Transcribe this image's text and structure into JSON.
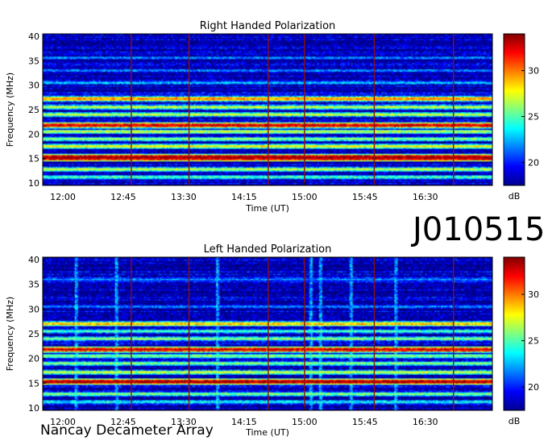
{
  "observation_id": "J010515",
  "instrument": "Nancay Decameter Array",
  "chart_data": [
    {
      "type": "heatmap",
      "title": "Right Handed Polarization",
      "xlabel": "Time (UT)",
      "ylabel": "Frequency (MHz)",
      "x_ticks": [
        "12:00",
        "12:45",
        "13:30",
        "14:15",
        "15:00",
        "15:45",
        "16:30"
      ],
      "x_range_minutes": [
        705,
        1040
      ],
      "x_tick_minutes": [
        720,
        765,
        810,
        855,
        900,
        945,
        990
      ],
      "y_ticks": [
        10,
        15,
        20,
        25,
        30,
        35,
        40
      ],
      "ylim": [
        9.5,
        40.5
      ],
      "colorbar": {
        "label": "dB",
        "ticks": [
          20,
          25,
          30
        ],
        "range": [
          17.5,
          34
        ]
      },
      "interference_bands_mhz": [
        {
          "f": 15.3,
          "level": 34
        },
        {
          "f": 15.0,
          "level": 33
        },
        {
          "f": 21.8,
          "level": 33
        },
        {
          "f": 20.5,
          "level": 27
        },
        {
          "f": 19.0,
          "level": 26
        },
        {
          "f": 17.5,
          "level": 28
        },
        {
          "f": 24.0,
          "level": 27
        },
        {
          "f": 25.5,
          "level": 27
        },
        {
          "f": 27.2,
          "level": 30
        },
        {
          "f": 12.8,
          "level": 27
        },
        {
          "f": 11.2,
          "level": 25
        },
        {
          "f": 30.5,
          "level": 23
        },
        {
          "f": 33.0,
          "level": 22
        },
        {
          "f": 35.6,
          "level": 22
        }
      ],
      "vertical_spikes_minutes": [
        771,
        814,
        873,
        900,
        952,
        1011
      ]
    },
    {
      "type": "heatmap",
      "title": "Left Handed Polarization",
      "xlabel": "Time (UT)",
      "ylabel": "Frequency (MHz)",
      "x_ticks": [
        "12:00",
        "12:45",
        "13:30",
        "14:15",
        "15:00",
        "15:45",
        "16:30"
      ],
      "x_range_minutes": [
        705,
        1040
      ],
      "x_tick_minutes": [
        720,
        765,
        810,
        855,
        900,
        945,
        990
      ],
      "y_ticks": [
        10,
        15,
        20,
        25,
        30,
        35,
        40
      ],
      "ylim": [
        9.5,
        40.5
      ],
      "colorbar": {
        "label": "dB",
        "ticks": [
          20,
          25,
          30
        ],
        "range": [
          17.5,
          34
        ]
      },
      "interference_bands_mhz": [
        {
          "f": 15.3,
          "level": 34
        },
        {
          "f": 21.8,
          "level": 33
        },
        {
          "f": 27.0,
          "level": 29
        },
        {
          "f": 20.5,
          "level": 26
        },
        {
          "f": 19.0,
          "level": 26
        },
        {
          "f": 17.2,
          "level": 27
        },
        {
          "f": 24.0,
          "level": 26
        },
        {
          "f": 25.5,
          "level": 25
        },
        {
          "f": 12.8,
          "level": 26
        },
        {
          "f": 11.2,
          "level": 24
        },
        {
          "f": 30.5,
          "level": 22
        },
        {
          "f": 36.0,
          "level": 22
        }
      ],
      "vertical_spikes_minutes": [
        771,
        814,
        873,
        900,
        952,
        1011
      ],
      "broadband_bursts_minutes": [
        730,
        760,
        835,
        905,
        912,
        935,
        968
      ]
    }
  ]
}
